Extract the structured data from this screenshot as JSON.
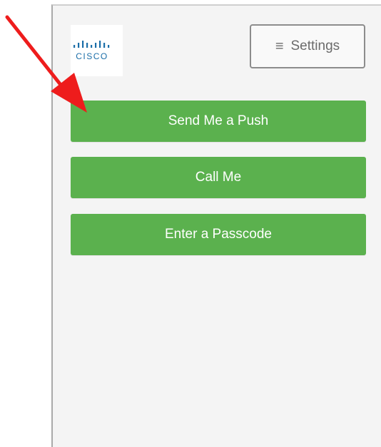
{
  "logo": {
    "text": "CISCO"
  },
  "settings": {
    "icon": "hamburger-icon",
    "label": "Settings"
  },
  "auth_options": [
    {
      "label": "Send Me a Push"
    },
    {
      "label": "Call Me"
    },
    {
      "label": "Enter a Passcode"
    }
  ],
  "colors": {
    "button_green": "#5bb14e",
    "panel_bg": "#f4f4f4",
    "arrow_red": "#ee1c1c"
  }
}
